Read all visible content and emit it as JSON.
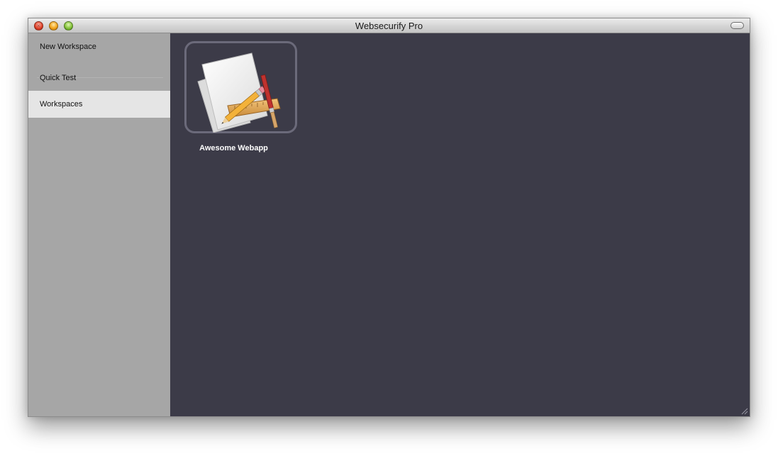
{
  "window": {
    "title": "Websecurify Pro"
  },
  "sidebar": {
    "items": [
      {
        "label": "New Workspace",
        "selected": false
      },
      {
        "label": "Quick Test",
        "selected": false
      },
      {
        "label": "Workspaces",
        "selected": true
      }
    ]
  },
  "workspaces": [
    {
      "name": "Awesome Webapp",
      "icon": "drafting-document-icon"
    }
  ],
  "colors": {
    "content_bg": "#3c3b48",
    "sidebar_bg": "#a6a6a6",
    "sidebar_selected_bg": "#e5e5e5",
    "tile_border": "#6b6a7a"
  }
}
